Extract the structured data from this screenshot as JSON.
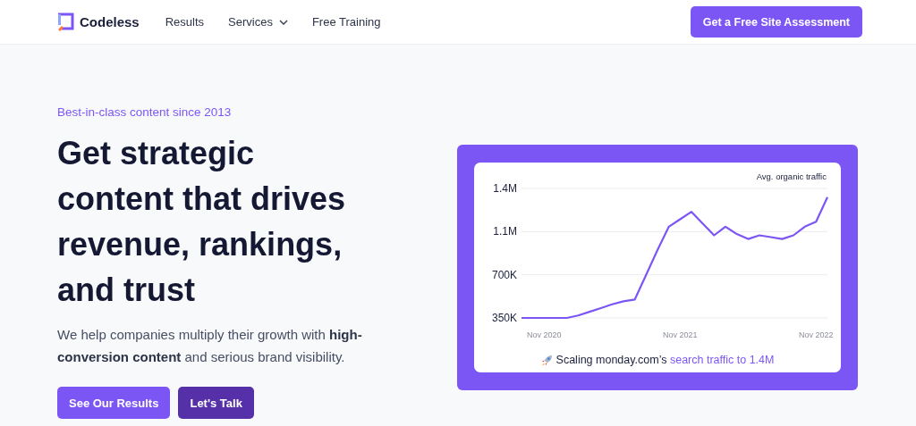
{
  "nav": {
    "brand": "Codeless",
    "links": [
      {
        "label": "Results",
        "dropdown": false
      },
      {
        "label": "Services",
        "dropdown": true
      },
      {
        "label": "Free Training",
        "dropdown": false
      }
    ],
    "cta": "Get a Free Site Assessment"
  },
  "hero": {
    "eyebrow": "Best-in-class content since 2013",
    "heading": "Get strategic content that drives revenue, rankings, and trust",
    "text": "We help companies multiply their growth with **high-conversion content** and serious brand visibility.",
    "buttons": [
      {
        "label": "See Our Results",
        "kind": "primary"
      },
      {
        "label": "Let's Talk",
        "kind": "secondary"
      }
    ]
  },
  "chart_card": {
    "chart_data": {
      "type": "line",
      "categories": [
        null,
        null,
        "Nov 2020",
        null,
        null,
        null,
        null,
        null,
        null,
        null,
        null,
        null,
        null,
        null,
        "Nov 2021",
        null,
        null,
        null,
        null,
        null,
        null,
        null,
        null,
        null,
        null,
        null,
        "Nov 2022",
        null
      ],
      "series": [
        {
          "name": "Avg. organic traffic",
          "color": "#7c56f5",
          "values": [
            350000,
            350000,
            350000,
            350000,
            350000,
            370000,
            400000,
            430000,
            460000,
            485000,
            500000,
            700000,
            900000,
            1090000,
            1150000,
            1210000,
            1115000,
            1020000,
            1090000,
            1030000,
            990000,
            1020000,
            1005000,
            990000,
            1020000,
            1090000,
            1130000,
            1330000
          ]
        }
      ],
      "ylim": [
        350000,
        1400000
      ],
      "yticks": [
        {
          "value": 350000,
          "label": "350K"
        },
        {
          "value": 700000,
          "label": "700K"
        },
        {
          "value": 1050000,
          "label": "1.1M"
        },
        {
          "value": 1400000,
          "label": "1.4M"
        }
      ]
    },
    "caption": "Scaling monday.com’s",
    "caption_link": "search traffic to 1.4M"
  }
}
